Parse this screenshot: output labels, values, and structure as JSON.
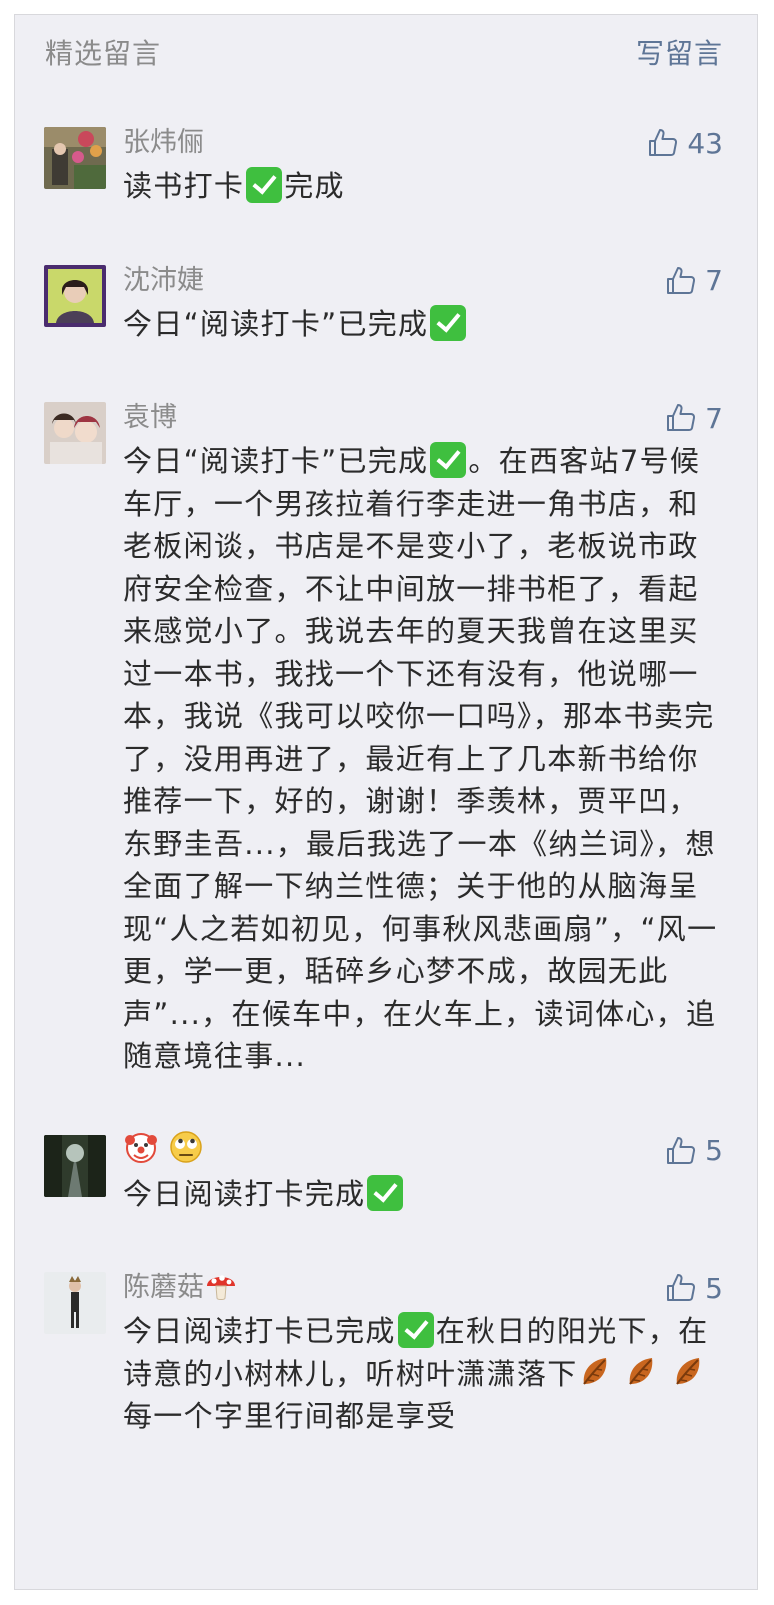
{
  "header": {
    "title": "精选留言",
    "write_label": "写留言"
  },
  "comments": [
    {
      "name": "张炜俪",
      "likes": "43",
      "segments": [
        "读书打卡",
        "完成"
      ]
    },
    {
      "name": "沈沛婕",
      "likes": "7",
      "segments": [
        "今日“阅读打卡”已完成"
      ]
    },
    {
      "name": "袁博",
      "likes": "7",
      "segments": [
        "今日“阅读打卡”已完成",
        "。在西客站7号候车厅，一个男孩拉着行李走进一角书店，和老板闲谈，书店是不是变小了，老板说市政府安全检查，不让中间放一排书柜了，看起来感觉小了。我说去年的夏天我曾在这里买过一本书，我找一个下还有没有，他说哪一本，我说《我可以咬你一口吗》，那本书卖完了，没用再进了，最近有上了几本新书给你推荐一下，好的，谢谢！季羡林，贾平凹，东野圭吾...，最后我选了一本《纳兰词》，想全面了解一下纳兰性德；关于他的从脑海呈现“人之若如初见，何事秋风悲画扇”，“风一更，学一更，聒碎乡心梦不成，故园无此声”...，在候车中，在火车上，读词体心，追随意境往事..."
      ]
    },
    {
      "name": "",
      "name_icons": [
        "clown-face-icon",
        "eye-roll-face-icon"
      ],
      "likes": "5",
      "segments": [
        "今日阅读打卡完成"
      ]
    },
    {
      "name": "陈蘑菇",
      "name_icons": [
        "mushroom-icon"
      ],
      "likes": "5",
      "segments": [
        "今日阅读打卡已完成",
        "在秋日的阳光下，在诗意的小树林儿，听树叶潇潇落下",
        " 每一个字里行间都是享受"
      ]
    }
  ],
  "icons": {
    "like": "thumbs-up-icon",
    "check": "check-mark-button-icon",
    "leaf": "fallen-leaf-icon"
  },
  "colors": {
    "link": "#5e7596",
    "muted": "#8b8b8b",
    "text": "#2b2b2b",
    "background": "#efeff4",
    "check": "#3fbf3f"
  }
}
